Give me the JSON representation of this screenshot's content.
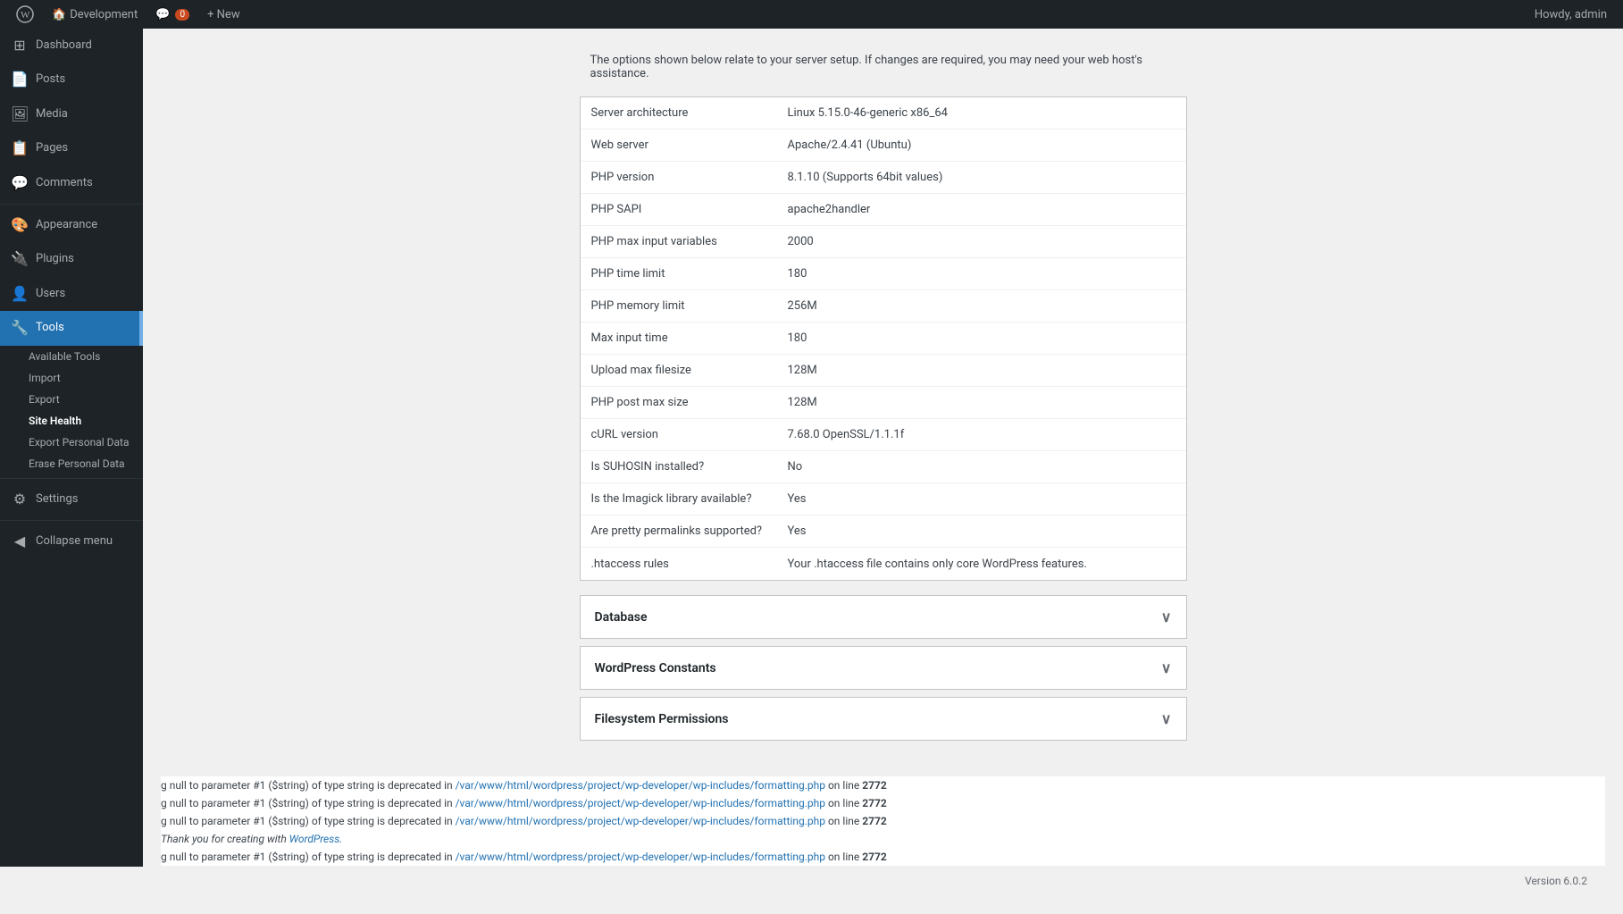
{
  "adminbar": {
    "wp_label": "WordPress",
    "site_name": "Development",
    "comments_count": "0",
    "new_label": "+ New",
    "howdy": "Howdy, admin"
  },
  "sidebar": {
    "items": [
      {
        "id": "dashboard",
        "label": "Dashboard",
        "icon": "⊞"
      },
      {
        "id": "posts",
        "label": "Posts",
        "icon": "📄"
      },
      {
        "id": "media",
        "label": "Media",
        "icon": "🖼"
      },
      {
        "id": "pages",
        "label": "Pages",
        "icon": "📋"
      },
      {
        "id": "comments",
        "label": "Comments",
        "icon": "💬"
      },
      {
        "id": "appearance",
        "label": "Appearance",
        "icon": "🎨"
      },
      {
        "id": "plugins",
        "label": "Plugins",
        "icon": "🔌"
      },
      {
        "id": "users",
        "label": "Users",
        "icon": "👤"
      },
      {
        "id": "tools",
        "label": "Tools",
        "icon": "🔧",
        "active": true
      }
    ],
    "tools_submenu": [
      {
        "id": "available-tools",
        "label": "Available Tools"
      },
      {
        "id": "import",
        "label": "Import"
      },
      {
        "id": "export",
        "label": "Export"
      },
      {
        "id": "site-health",
        "label": "Site Health",
        "active": true
      },
      {
        "id": "export-personal-data",
        "label": "Export Personal Data"
      },
      {
        "id": "erase-personal-data",
        "label": "Erase Personal Data"
      }
    ],
    "settings_label": "Settings",
    "collapse_label": "Collapse menu"
  },
  "notice": {
    "text": "The options shown below relate to your server setup. If changes are required, you may need your web host's assistance."
  },
  "server_info": {
    "rows": [
      {
        "label": "Server architecture",
        "value": "Linux 5.15.0-46-generic x86_64"
      },
      {
        "label": "Web server",
        "value": "Apache/2.4.41 (Ubuntu)"
      },
      {
        "label": "PHP version",
        "value": "8.1.10 (Supports 64bit values)"
      },
      {
        "label": "PHP SAPI",
        "value": "apache2handler"
      },
      {
        "label": "PHP max input variables",
        "value": "2000"
      },
      {
        "label": "PHP time limit",
        "value": "180"
      },
      {
        "label": "PHP memory limit",
        "value": "256M"
      },
      {
        "label": "Max input time",
        "value": "180"
      },
      {
        "label": "Upload max filesize",
        "value": "128M"
      },
      {
        "label": "PHP post max size",
        "value": "128M"
      },
      {
        "label": "cURL version",
        "value": "7.68.0 OpenSSL/1.1.1f"
      },
      {
        "label": "Is SUHOSIN installed?",
        "value": "No"
      },
      {
        "label": "Is the Imagick library available?",
        "value": "Yes"
      },
      {
        "label": "Are pretty permalinks supported?",
        "value": "Yes"
      },
      {
        "label": ".htaccess rules",
        "value": "Your .htaccess file contains only core WordPress features."
      }
    ]
  },
  "collapsibles": [
    {
      "id": "database",
      "label": "Database"
    },
    {
      "id": "wp-constants",
      "label": "WordPress Constants"
    },
    {
      "id": "filesystem-permissions",
      "label": "Filesystem Permissions"
    }
  ],
  "error_log": {
    "lines": [
      {
        "prefix": "g null to parameter #1 ($string) of type string is deprecated in ",
        "path": "/var/www/html/wordpress/project/wp-developer/wp-includes/formatting.php",
        "suffix": " on line ",
        "line_num": "2772"
      },
      {
        "prefix": "g null to parameter #1 ($string) of type string is deprecated in ",
        "path": "/var/www/html/wordpress/project/wp-developer/wp-includes/formatting.php",
        "suffix": " on line ",
        "line_num": "2772"
      },
      {
        "prefix": "g null to parameter #1 ($string) of type string is deprecated in ",
        "path": "/var/www/html/wordpress/project/wp-developer/wp-includes/formatting.php",
        "suffix": " on line ",
        "line_num": "2772"
      },
      {
        "prefix": "Thank you for creating with ",
        "link_text": "WordPress.",
        "is_thanks": true
      },
      {
        "prefix": "g null to parameter #1 ($string) of type string is deprecated in ",
        "path": "/var/www/html/wordpress/project/wp-developer/wp-includes/formatting.php",
        "suffix": " on line ",
        "line_num": "2772"
      }
    ]
  },
  "footer": {
    "version": "Version 6.0.2"
  },
  "icons": {
    "wordpress": "ⓦ",
    "house": "🏠",
    "comment_bubble": "💬",
    "plus": "+",
    "chevron_down": "∨"
  }
}
